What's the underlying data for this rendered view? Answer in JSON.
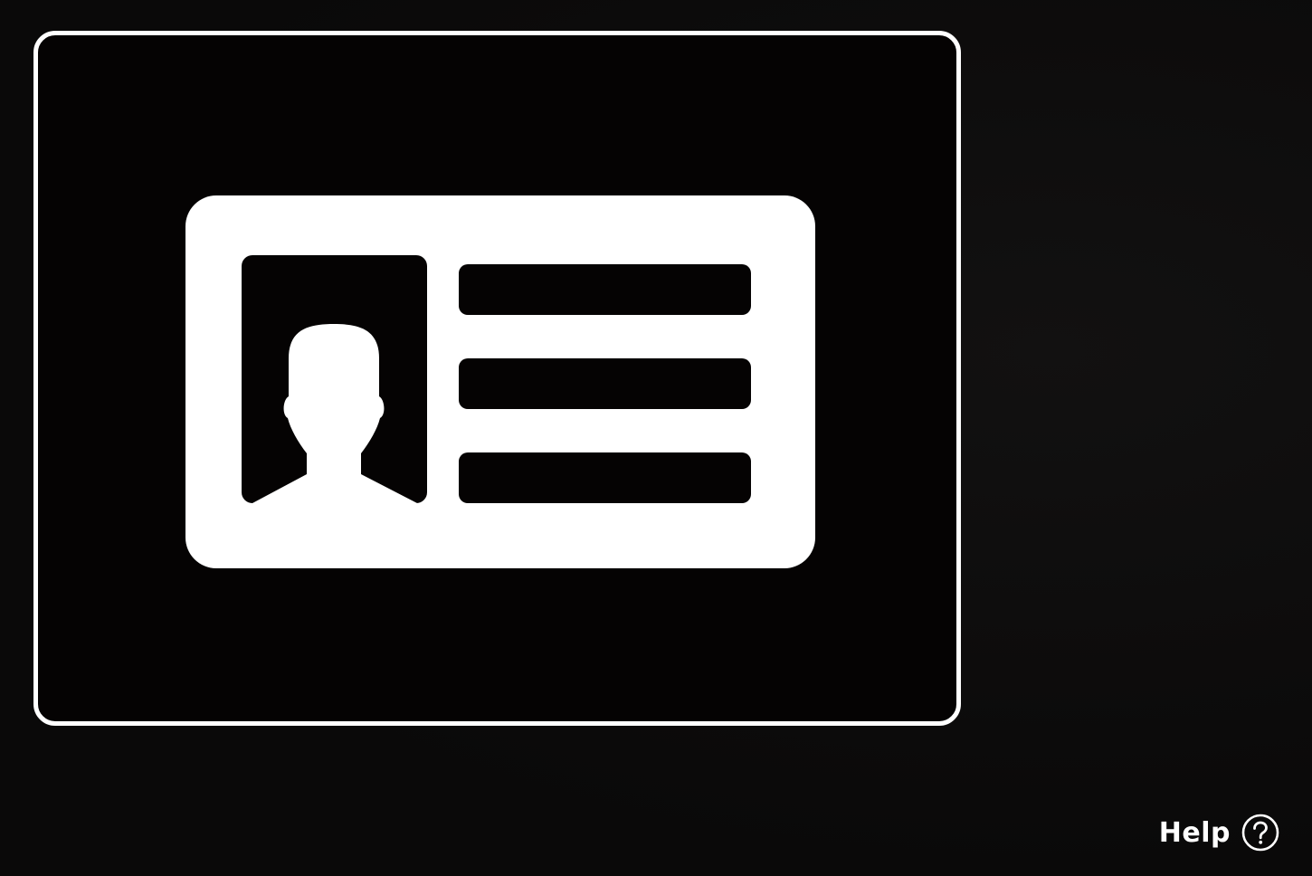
{
  "help": {
    "label": "Help",
    "icon": "question-circle-icon"
  },
  "capture": {
    "illustration_icon": "id-card-icon"
  },
  "colors": {
    "background": "#0b0a0a",
    "frame_border": "#ffffff",
    "frame_fill": "#050303",
    "card_fill": "#ffffff",
    "card_detail": "#050303"
  }
}
